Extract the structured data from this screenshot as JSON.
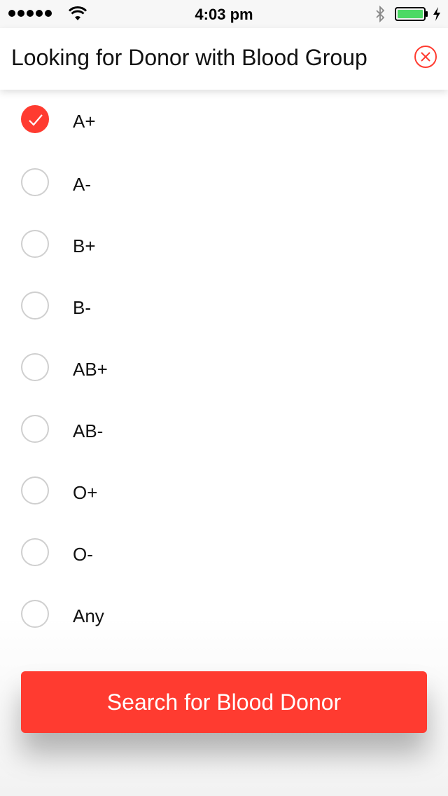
{
  "status_bar": {
    "time": "4:03 pm",
    "signal_icon": "signal-dots-icon",
    "wifi_icon": "wifi-icon",
    "bluetooth_icon": "bluetooth-icon",
    "battery_icon": "battery-icon",
    "battery_color": "#4cd964"
  },
  "header": {
    "title": "Looking for Donor with Blood Group",
    "close_icon": "close-circle-icon"
  },
  "blood_groups": [
    {
      "label": "A+",
      "selected": true
    },
    {
      "label": "A-",
      "selected": false
    },
    {
      "label": "B+",
      "selected": false
    },
    {
      "label": "B-",
      "selected": false
    },
    {
      "label": "AB+",
      "selected": false
    },
    {
      "label": "AB-",
      "selected": false
    },
    {
      "label": "O+",
      "selected": false
    },
    {
      "label": "O-",
      "selected": false
    },
    {
      "label": "Any",
      "selected": false
    }
  ],
  "search_button": {
    "label": "Search for Blood Donor"
  },
  "colors": {
    "accent": "#ff3b30",
    "radio_border": "#cfcfcf"
  }
}
